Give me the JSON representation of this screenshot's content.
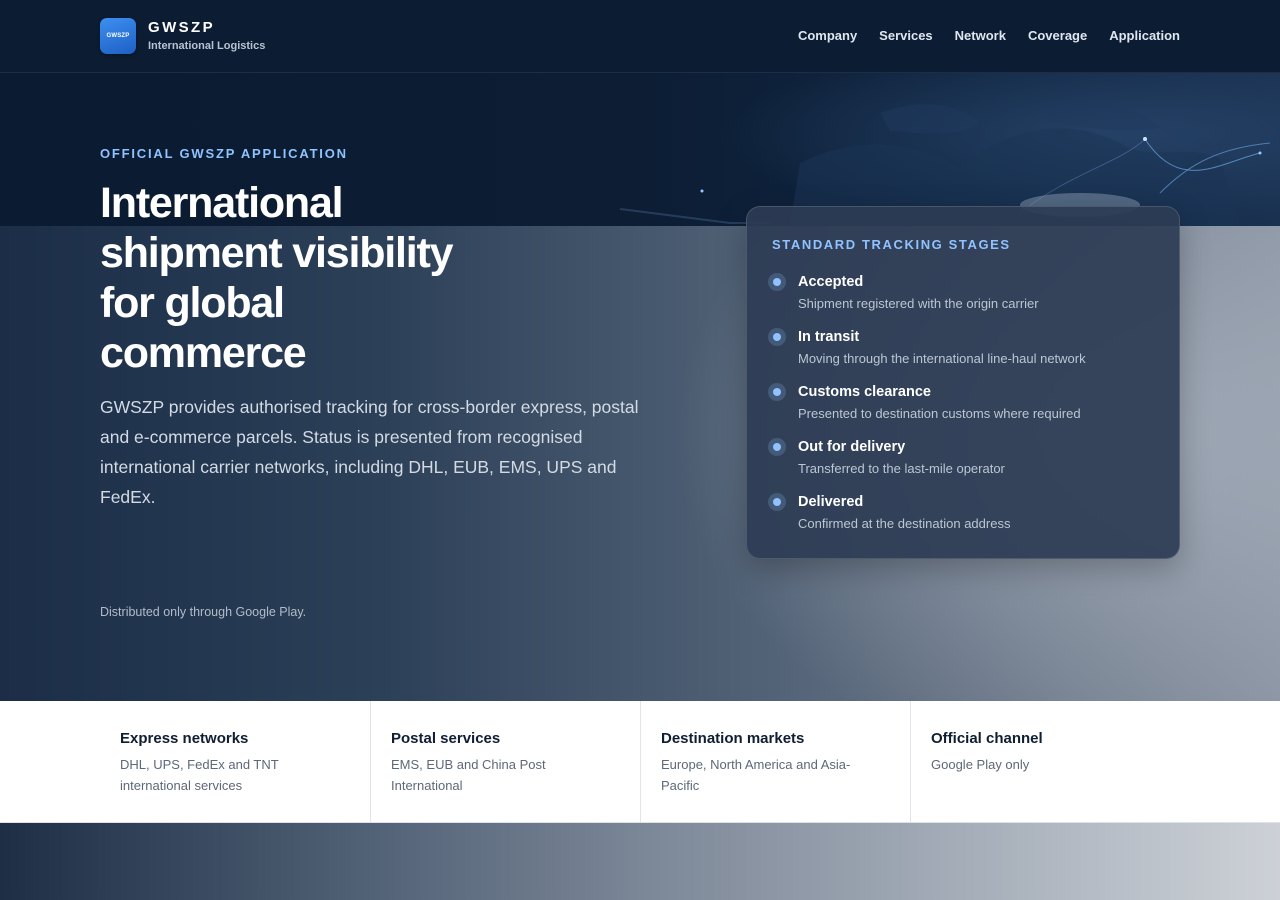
{
  "header": {
    "logo_text": "GWSZP",
    "brand_name": "GWSZP",
    "brand_subtitle": "International Logistics",
    "nav": [
      {
        "label": "Company"
      },
      {
        "label": "Services"
      },
      {
        "label": "Network"
      },
      {
        "label": "Coverage"
      },
      {
        "label": "Application"
      }
    ]
  },
  "hero": {
    "eyebrow": "OFFICIAL GWSZP APPLICATION",
    "title": "International shipment visibility for global commerce",
    "description": "GWSZP provides authorised tracking for cross-border express, postal and e-commerce parcels. Status is presented from recognised international carrier networks, including DHL, EUB, EMS, UPS and FedEx.",
    "note": "Distributed only through Google Play."
  },
  "tracking": {
    "title": "STANDARD TRACKING STAGES",
    "stages": [
      {
        "name": "Accepted",
        "description": "Shipment registered with the origin carrier"
      },
      {
        "name": "In transit",
        "description": "Moving through the international line-haul network"
      },
      {
        "name": "Customs clearance",
        "description": "Presented to destination customs where required"
      },
      {
        "name": "Out for delivery",
        "description": "Transferred to the last-mile operator"
      },
      {
        "name": "Delivered",
        "description": "Confirmed at the destination address"
      }
    ]
  },
  "features": [
    {
      "title": "Express networks",
      "description": "DHL, UPS, FedEx and TNT international services"
    },
    {
      "title": "Postal services",
      "description": "EMS, EUB and China Post International"
    },
    {
      "title": "Destination markets",
      "description": "Europe, North America and Asia-Pacific"
    },
    {
      "title": "Official channel",
      "description": "Google Play only"
    }
  ],
  "colors": {
    "header_bg": "#0b1c33",
    "accent": "#8fc2ff",
    "logo_blue": "#2f7fe6",
    "card_bg": "#2c3c54"
  }
}
